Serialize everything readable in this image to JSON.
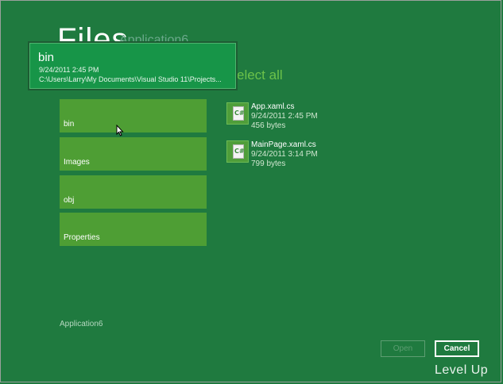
{
  "page": {
    "title": "Files",
    "subtitle": "Application6",
    "select_all": "elect all"
  },
  "tooltip": {
    "title": "bin",
    "date": "9/24/2011 2:45 PM",
    "path": "C:\\Users\\Larry\\My Documents\\Visual Studio 11\\Projects..."
  },
  "folders": [
    {
      "label": "bin"
    },
    {
      "label": "Images"
    },
    {
      "label": "obj"
    },
    {
      "label": "Properties"
    }
  ],
  "files": [
    {
      "name": "App.xaml.cs",
      "date": "9/24/2011 2:45 PM",
      "size": "456 bytes",
      "icon": "csharp-file-icon"
    },
    {
      "name": "MainPage.xaml.cs",
      "date": "9/24/2011 3:14 PM",
      "size": "799 bytes",
      "icon": "csharp-file-icon"
    }
  ],
  "footer": {
    "app_name": "Application6"
  },
  "buttons": {
    "open": "Open",
    "cancel": "Cancel"
  },
  "watermark": "Level Up",
  "colors": {
    "background": "#1f7a3f",
    "tile": "#4e9e34",
    "accent": "#6cc24a"
  }
}
